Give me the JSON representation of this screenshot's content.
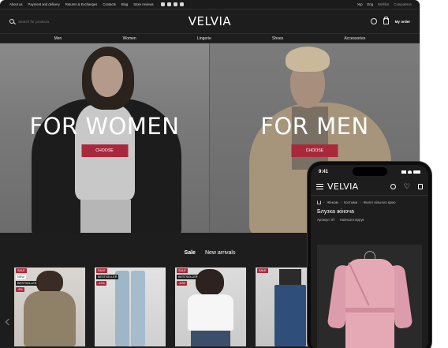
{
  "topbar": {
    "links": [
      "About us",
      "Payment and delivery",
      "Returns & Exchanges",
      "Contacts",
      "Blog",
      "Store reviews"
    ],
    "social_icons": [
      "instagram-icon",
      "tiktok-icon",
      "facebook-icon",
      "youtube-icon"
    ],
    "languages": [
      "Укр",
      "Eng"
    ],
    "wishlist_label": "Wishlist",
    "compare_label": "Comparison"
  },
  "header": {
    "search_placeholder": "Search for products",
    "logo": "VELVIA",
    "my_order": "My order"
  },
  "nav": [
    "Men",
    "Women",
    "Lingerie",
    "Shoes",
    "Accessories"
  ],
  "hero": {
    "women_title": "FOR WOMEN",
    "men_title": "FOR MEN",
    "choose_label": "CHOOSE"
  },
  "tabs": {
    "sale": "Sale",
    "new_arrivals": "New arrivals"
  },
  "products": [
    {
      "badges": [
        "SALE",
        "NEW",
        "BESTSELLER",
        "-9%"
      ]
    },
    {
      "badges": [
        "SALE",
        "BESTSELLER",
        "-12%"
      ]
    },
    {
      "badges": [
        "SALE",
        "BESTSELLER",
        "-10%"
      ]
    },
    {
      "badges": [
        "SALE"
      ]
    }
  ],
  "mobile": {
    "time": "9:41",
    "logo": "VELVIA",
    "breadcrumbs": [
      "Жінкам",
      "Костюми",
      "Жилет вільного крою"
    ],
    "product_title": "Блузка жіноча",
    "article_label": "Артикул: 87",
    "review_label": "Написати відгук"
  },
  "colors": {
    "accent": "#a8293b",
    "background": "#1d1d1d"
  }
}
